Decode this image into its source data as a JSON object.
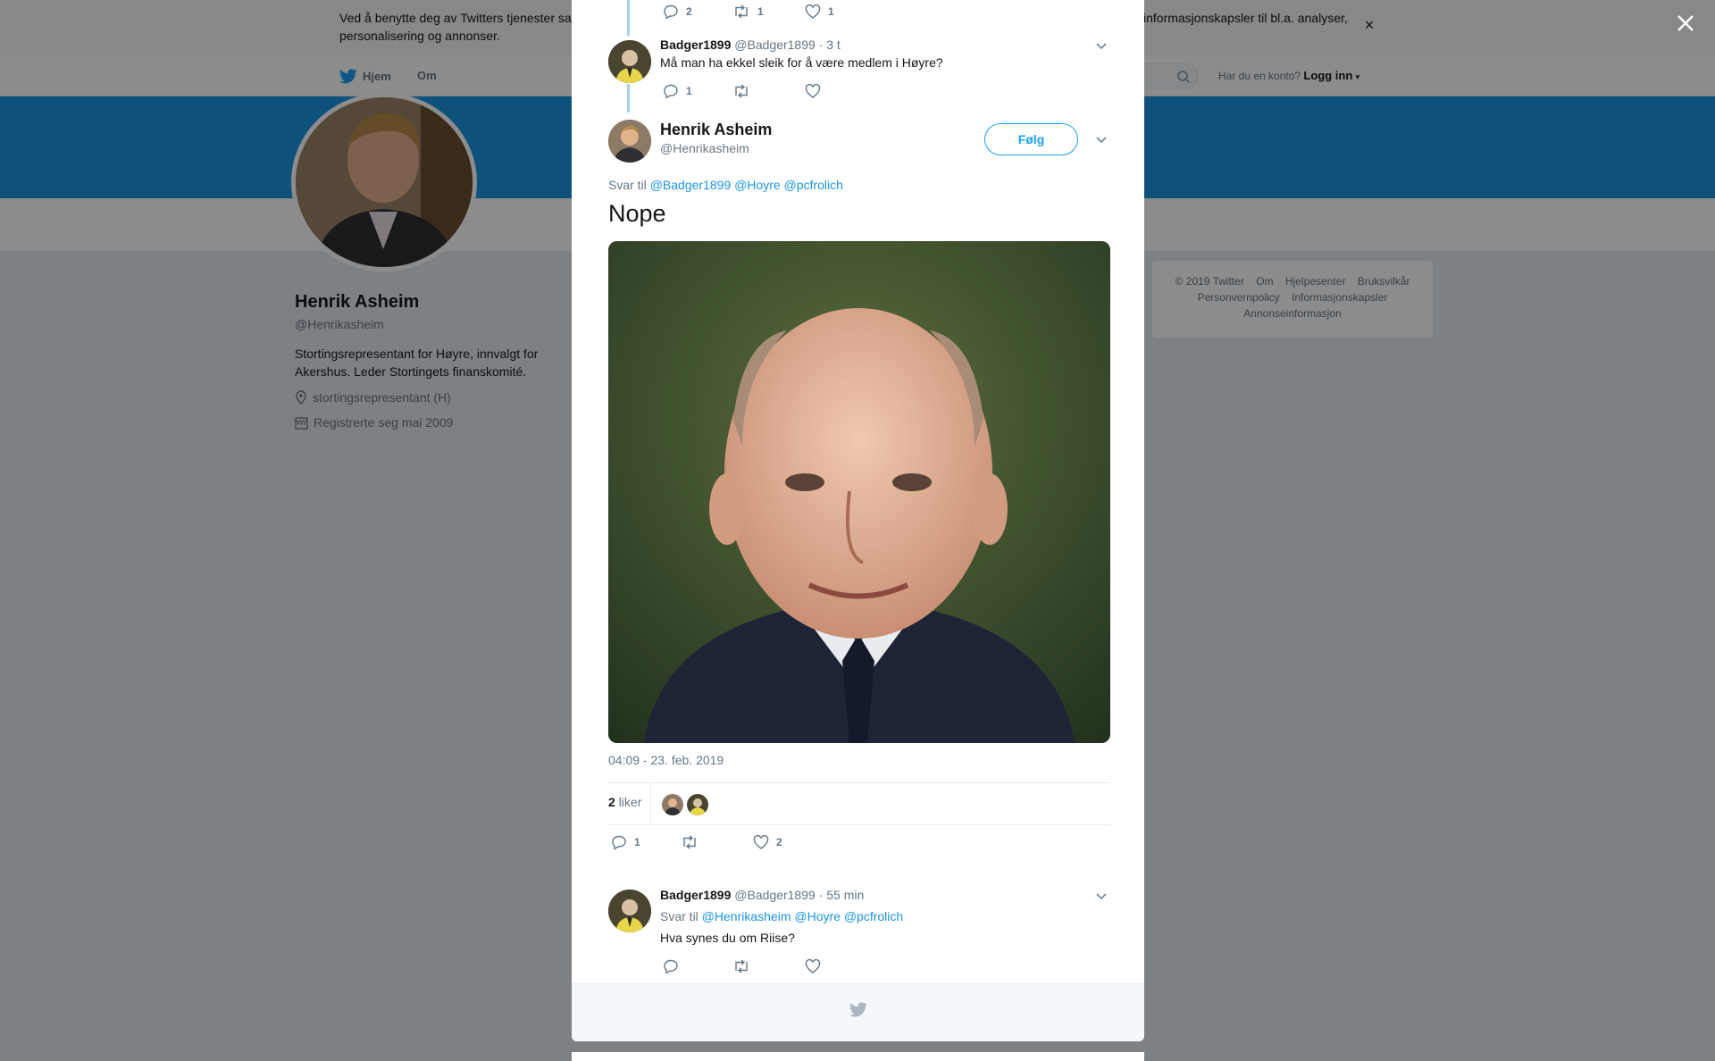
{
  "cookie_banner": {
    "text": "Ved å benytte deg av Twitters tjenester sa",
    "text_line2": "personalisering og annonser.",
    "text_right": "informasjonskapsler til bl.a. analyser,",
    "close_label": "×"
  },
  "nav": {
    "home_label": "Hjem",
    "about_label": "Om",
    "login_prompt": "Har du en konto?",
    "login_label": "Logg inn"
  },
  "profile": {
    "name": "Henrik Asheim",
    "handle": "@Henrikasheim",
    "bio": "Stortingsrepresentant for Høyre, innvalgt for Akershus. Leder Stortingets finanskomité.",
    "location": "stortingsrepresentant (H)",
    "joined": "Registrerte seg mai 2009"
  },
  "footer_links": {
    "copyright": "© 2019 Twitter",
    "about": "Om",
    "help": "Hjelpesenter",
    "terms": "Bruksvilkår",
    "privacy": "Personvernpolicy",
    "cookies": "Informasjonskapsler",
    "ads": "Annonseinformasjon"
  },
  "thread": {
    "prev_tweet_actions": {
      "replies": "2",
      "retweets": "1",
      "likes": "1"
    },
    "reply1": {
      "name": "Badger1899",
      "handle": "@Badger1899",
      "time": "· 3 t",
      "text": "Må man ha ekkel sleik for å være medlem i Høyre?",
      "replies": "1"
    },
    "main": {
      "name": "Henrik Asheim",
      "handle": "@Henrikasheim",
      "follow_label": "Følg",
      "reply_to_label": "Svar til",
      "mention1": "@Badger1899",
      "mention2": "@Hoyre",
      "mention3": "@pcfrolich",
      "text": "Nope",
      "timestamp": "04:09 - 23. feb. 2019",
      "likes_count": "2",
      "likes_label": "liker",
      "replies": "1",
      "likes": "2"
    },
    "reply2": {
      "name": "Badger1899",
      "handle": "@Badger1899",
      "time": "· 55 min",
      "reply_to_label": "Svar til",
      "mention1": "@Henrikasheim",
      "mention2": "@Hoyre",
      "mention3": "@pcfrolich",
      "text": "Hva synes du om Riise?"
    }
  },
  "colors": {
    "brand_blue": "#1da1f2",
    "header_blue": "#1b95e0",
    "thread_line": "#a3d3ee",
    "muted": "#657786"
  },
  "icons": [
    "twitter-bird-icon",
    "search-icon",
    "reply-icon",
    "retweet-icon",
    "like-icon",
    "chevron-down-icon",
    "location-icon",
    "calendar-icon",
    "close-icon"
  ]
}
